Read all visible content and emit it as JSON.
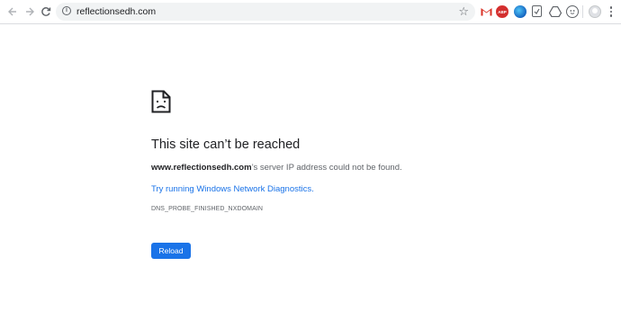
{
  "browser": {
    "url": "reflectionsedh.com",
    "extensions": [
      "gmail-icon",
      "adblock-icon",
      "globe-icon",
      "shield-icon",
      "drive-icon",
      "face-icon"
    ]
  },
  "error_page": {
    "title": "This site can’t be reached",
    "domain": "www.reflectionsedh.com",
    "message_suffix": "’s server IP address could not be found.",
    "diagnostics_link": "Try running Windows Network Diagnostics.",
    "error_code": "DNS_PROBE_FINISHED_NXDOMAIN",
    "reload_label": "Reload"
  },
  "colors": {
    "accent": "#1a73e8",
    "title": "#202124",
    "text": "#5f6368"
  }
}
